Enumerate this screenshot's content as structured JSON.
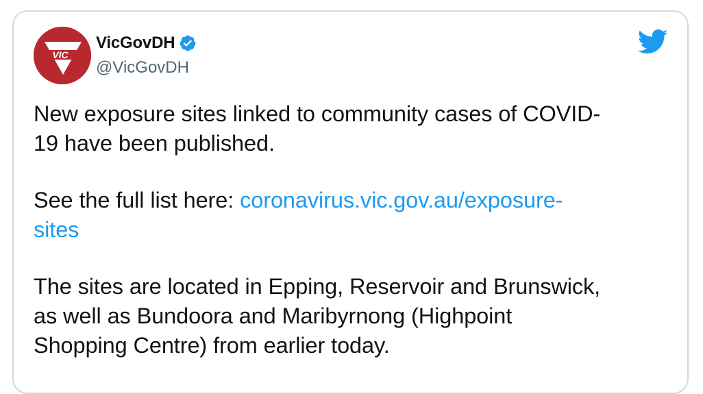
{
  "tweet": {
    "display_name": "VicGovDH",
    "handle": "@VicGovDH",
    "avatar_text": "VIC",
    "verified": true,
    "brand_icon": "twitter-bird-icon",
    "paragraph1_line1": "New exposure sites linked to community cases of COVID-",
    "paragraph1_line2": "19 have been published.",
    "paragraph2_prefix": "See the full list here: ",
    "paragraph2_link_line1": "coronavirus.vic.gov.au/exposure-",
    "paragraph2_link_line2": "sites",
    "paragraph3_line1": "The sites are located in Epping, Reservoir and Brunswick,",
    "paragraph3_line2": "as well as Bundoora and Maribyrnong (Highpoint",
    "paragraph3_line3": "Shopping Centre) from earlier today."
  },
  "colors": {
    "link": "#1d9bf0",
    "avatar_bg": "#b8282f",
    "border": "#cfd9de"
  }
}
